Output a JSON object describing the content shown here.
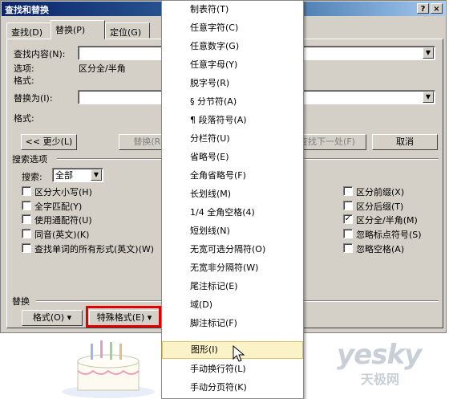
{
  "dialog": {
    "title": "查找和替换",
    "help_label": "?",
    "close_label": "×",
    "tabs": [
      {
        "label": "查找(D)"
      },
      {
        "label": "替换(P)"
      },
      {
        "label": "定位(G)"
      }
    ],
    "find": {
      "label": "查找内容(N):",
      "value": "",
      "options_label": "选项:",
      "options_value": "区分全/半角",
      "format_label": "格式:"
    },
    "replace": {
      "label": "替换为(I):",
      "value": "",
      "format_label": "格式:"
    },
    "buttons": {
      "less": "<< 更少(L)",
      "replace": "替换(R)",
      "find_next": "查找下一处(F)",
      "cancel": "取消"
    },
    "search_options": {
      "section_label": "搜索选项",
      "search_label": "搜索:",
      "search_value": "全部",
      "left_checks": [
        {
          "label": "区分大小写(H)",
          "checked": false
        },
        {
          "label": "全字匹配(Y)",
          "checked": false
        },
        {
          "label": "使用通配符(U)",
          "checked": false
        },
        {
          "label": "同音(英文)(K)",
          "checked": false
        },
        {
          "label": "查找单词的所有形式(英文)(W)",
          "checked": false
        }
      ],
      "right_checks": [
        {
          "label": "区分前缀(X)",
          "checked": false
        },
        {
          "label": "区分后缀(T)",
          "checked": false
        },
        {
          "label": "区分全/半角(M)",
          "checked": true
        },
        {
          "label": "忽略标点符号(S)",
          "checked": false
        },
        {
          "label": "忽略空格(A)",
          "checked": false
        }
      ]
    },
    "replace_section": {
      "label": "替换",
      "format_button": "格式(O) ▾",
      "special_button": "特殊格式(E) ▾"
    }
  },
  "special_menu": {
    "items": [
      {
        "label": "制表符(T)",
        "highlighted": false
      },
      {
        "label": "任意字符(C)",
        "highlighted": false
      },
      {
        "label": "任意数字(G)",
        "highlighted": false
      },
      {
        "label": "任意字母(Y)",
        "highlighted": false
      },
      {
        "label": "脱字号(R)",
        "highlighted": false
      },
      {
        "label": "§ 分节符(A)",
        "highlighted": false
      },
      {
        "label": "¶ 段落符号(A)",
        "highlighted": false
      },
      {
        "label": "分栏符(U)",
        "highlighted": false
      },
      {
        "label": "省略号(E)",
        "highlighted": false
      },
      {
        "label": "全角省略号(F)",
        "highlighted": false
      },
      {
        "label": "长划线(M)",
        "highlighted": false
      },
      {
        "label": "1/4 全角空格(4)",
        "highlighted": false
      },
      {
        "label": "短划线(N)",
        "highlighted": false
      },
      {
        "label": "无宽可选分隔符(O)",
        "highlighted": false
      },
      {
        "label": "无宽非分隔符(W)",
        "highlighted": false
      },
      {
        "label": "尾注标记(E)",
        "highlighted": false
      },
      {
        "label": "域(D)",
        "highlighted": false
      },
      {
        "label": "脚注标记(F)",
        "highlighted": false
      },
      {
        "label": "图形(I)",
        "highlighted": true
      },
      {
        "label": "手动换行符(L)",
        "highlighted": false
      },
      {
        "label": "手动分页符(K)",
        "highlighted": false
      }
    ]
  },
  "watermark": {
    "brand": "yesky",
    "sub": "天极网"
  },
  "colors": {
    "titlebar": "#0a246a",
    "dialog_bg": "#d4d0c8",
    "menu_highlight": "#fbf2c8",
    "annotation_red": "#e00000"
  }
}
